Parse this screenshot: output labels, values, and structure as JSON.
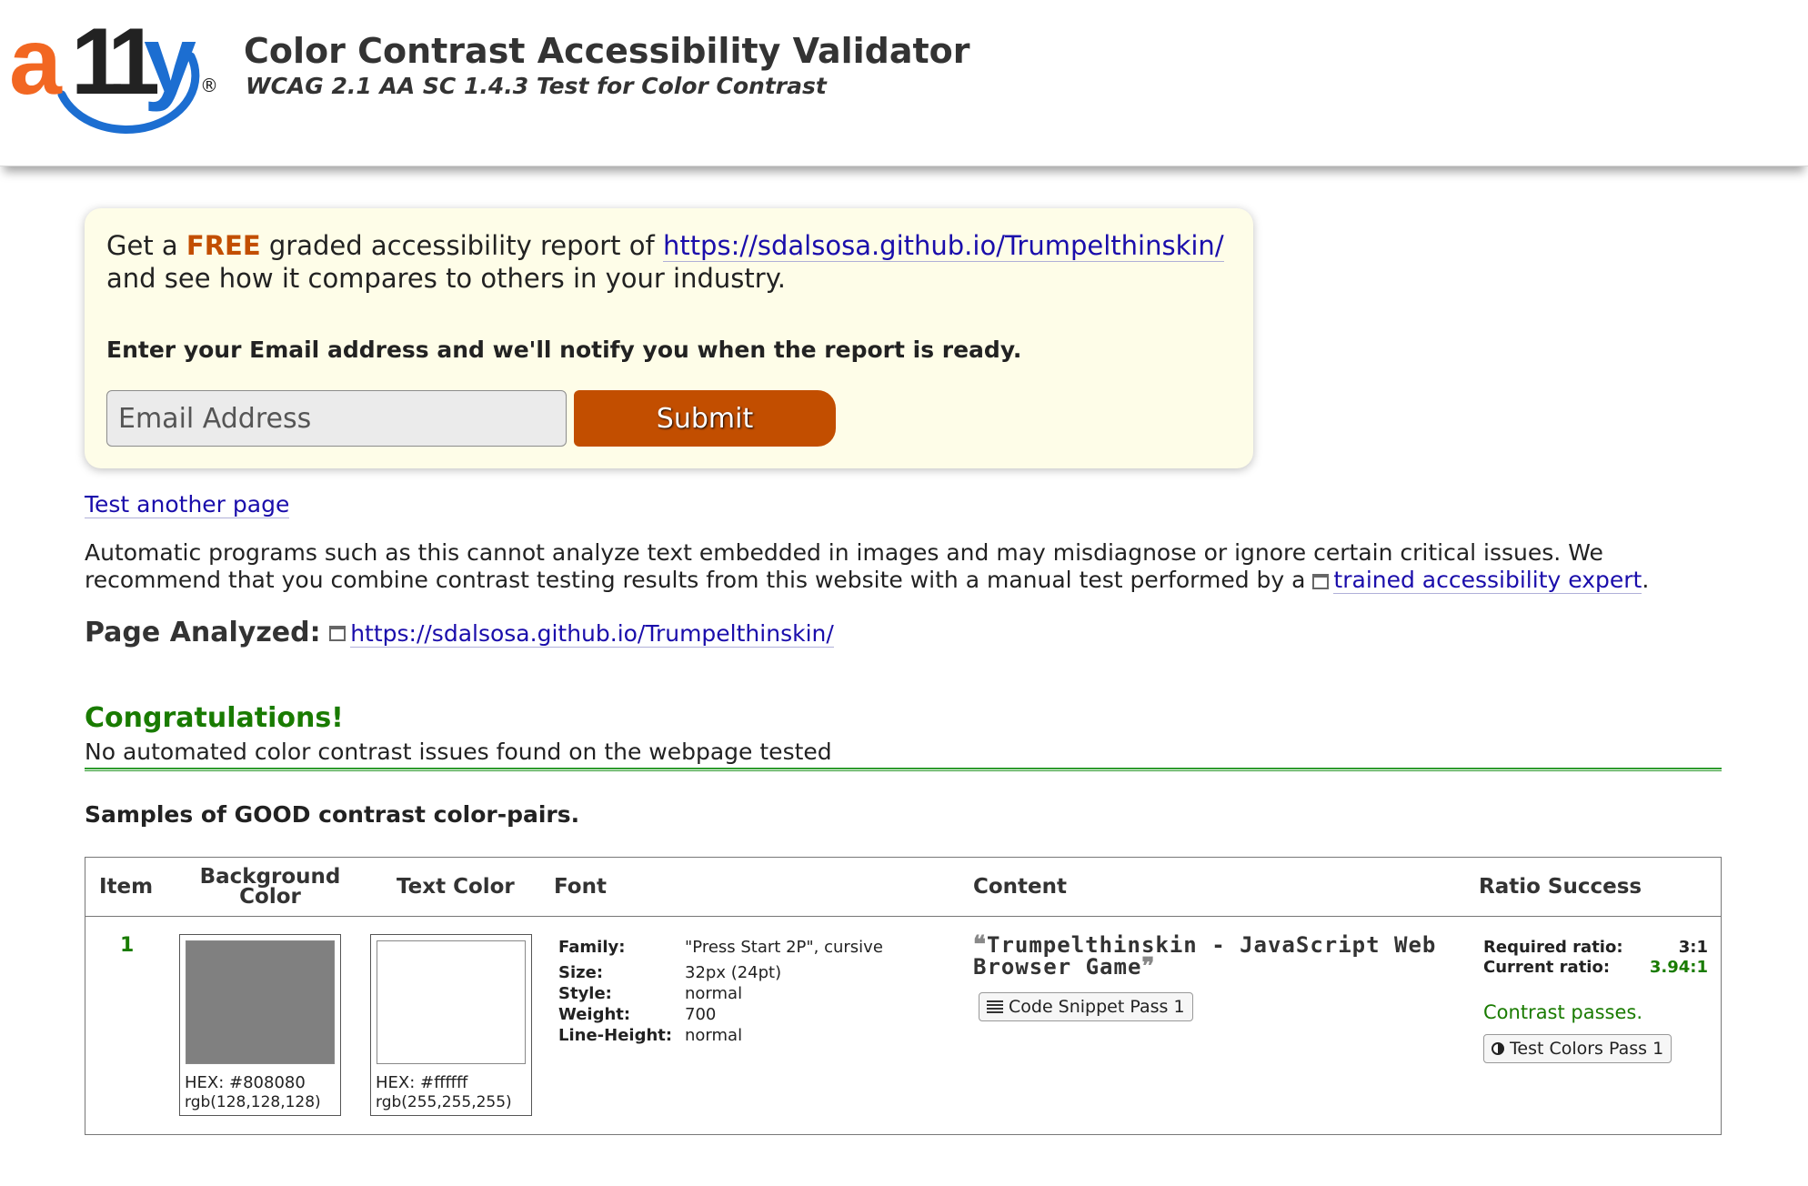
{
  "header": {
    "logo_a": "a",
    "logo_11": "11",
    "logo_y": "y",
    "logo_reg": "®",
    "title": "Color Contrast Accessibility Validator",
    "subtitle": "WCAG 2.1 AA SC 1.4.3 Test for Color Contrast"
  },
  "promo": {
    "get_a": "Get a ",
    "free": "FREE",
    "graded": " graded accessibility report of ",
    "url": "https://sdalsosa.github.io/Trumpelthinskin/",
    "line2": "and see how it compares to others in your industry.",
    "notify": "Enter your Email address and we'll notify you when the report is ready.",
    "email_placeholder": "Email Address",
    "submit_label": "Submit"
  },
  "test_another": "Test another page",
  "disclaimer": {
    "text": "Automatic programs such as this cannot analyze text embedded in images and may misdiagnose or ignore certain critical issues. We recommend that you combine contrast testing results from this website with a manual test performed by a ",
    "link": "trained accessibility expert",
    "end": "."
  },
  "page_analyzed": {
    "label": "Page Analyzed:",
    "url": "https://sdalsosa.github.io/Trumpelthinskin/"
  },
  "result": {
    "title": "Congratulations!",
    "message": "No automated color contrast issues found on the webpage tested"
  },
  "samples_title": "Samples of GOOD contrast color-pairs.",
  "table": {
    "headers": {
      "item": "Item",
      "background": "Background Color",
      "text_color": "Text Color",
      "font": "Font",
      "content": "Content",
      "ratio": "Ratio Success"
    },
    "rows": [
      {
        "item": "1",
        "bg_color": "#808080",
        "bg_hex": "HEX: #808080",
        "bg_rgb": "rgb(128,128,128)",
        "text_color": "#ffffff",
        "text_hex": "HEX: #ffffff",
        "text_rgb": "rgb(255,255,255)",
        "font_labels": {
          "family": "Family:",
          "size": "Size:",
          "style": "Style:",
          "weight": "Weight:",
          "line_height": "Line-Height:"
        },
        "font_values": {
          "family": "\"Press Start 2P\", cursive",
          "size": "32px (24pt)",
          "style": "normal",
          "weight": "700",
          "line_height": "normal"
        },
        "content": "Trumpelthinskin - JavaScript Web Browser Game",
        "snippet_label": "Code Snippet Pass 1",
        "required_label": "Required ratio:",
        "required_value": "3:1",
        "current_label": "Current ratio:",
        "current_value": "3.94:1",
        "status": "Contrast passes.",
        "test_colors_label": "Test Colors Pass 1"
      }
    ]
  },
  "colors": {
    "brand_orange": "#f26722",
    "brand_blue": "#1c6ed1",
    "submit_bg": "#c24e00",
    "promo_bg": "#fefde8",
    "success_green": "#197b00",
    "link_blue": "#1a0dab"
  },
  "icons": [
    "external-link-icon",
    "lines-icon",
    "contrast-icon",
    "quote-icon"
  ]
}
